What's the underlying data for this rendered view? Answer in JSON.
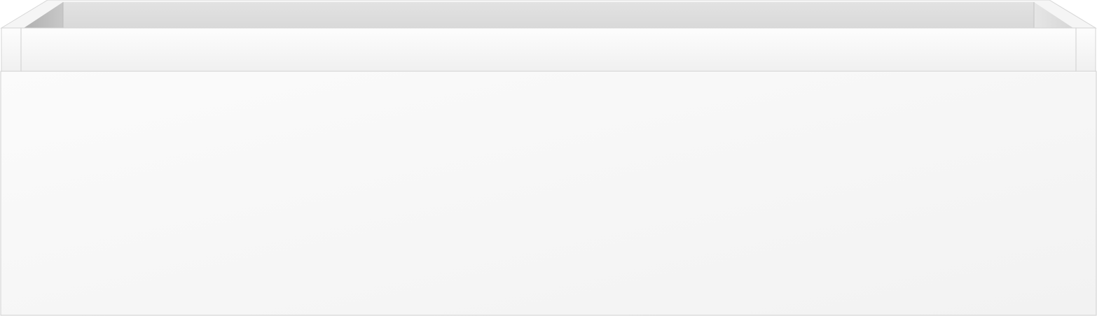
{
  "scene": {
    "object_icon": "open-drawer-box",
    "colors": {
      "background": "#ffffff",
      "front_panel_light": "#fbfbfb",
      "front_panel_dark": "#f2f2f2",
      "back_wall": "#dedede",
      "inner_side_shadow": "#b9b9b9",
      "top_lip": "#f7f7f7",
      "edge_line": "#cfcfcf"
    }
  }
}
